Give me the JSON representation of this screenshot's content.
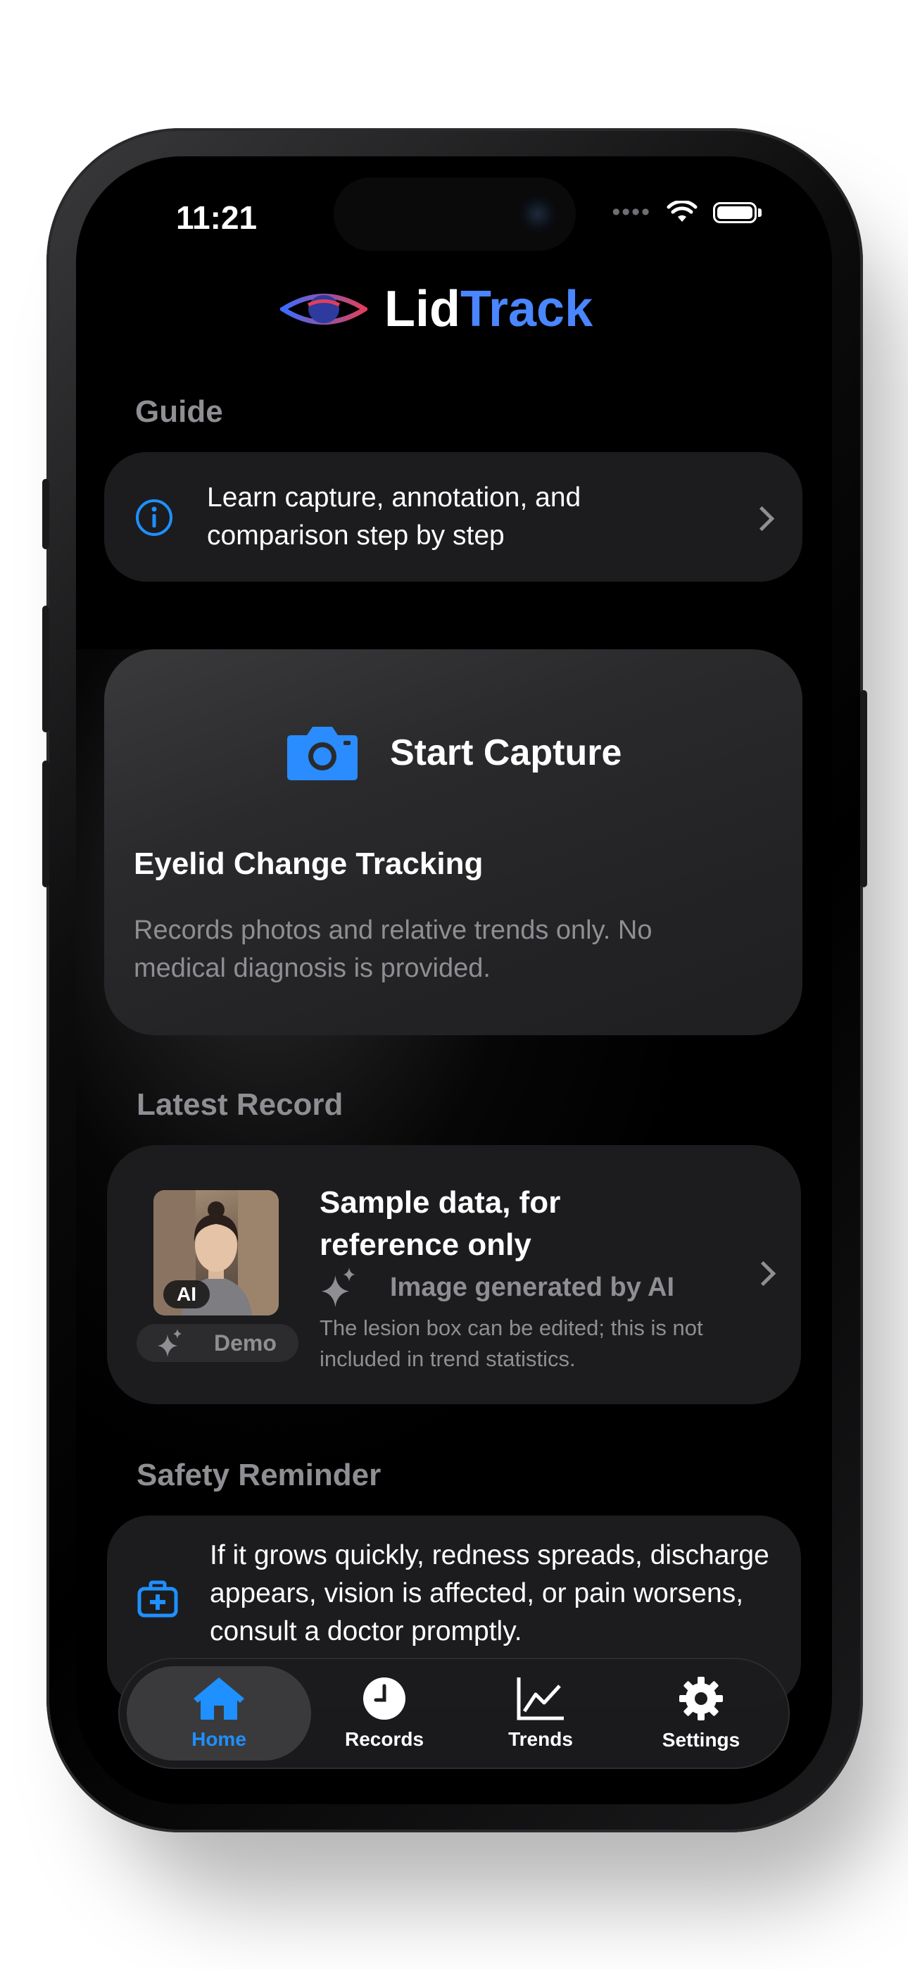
{
  "status_bar": {
    "time": "11:21"
  },
  "brand": {
    "part1": "Lid",
    "part2": "Track"
  },
  "guide": {
    "section_title": "Guide",
    "text": "Learn capture, annotation, and comparison step by step"
  },
  "capture": {
    "button_label": "Start Capture",
    "title": "Eyelid Change Tracking",
    "description": "Records photos and relative trends only. No medical diagnosis is provided."
  },
  "latest_record": {
    "section_title": "Latest Record",
    "thumbnail_badge": "AI",
    "demo_label": "Demo",
    "title": "Sample data, for reference only",
    "ai_label": "Image generated by AI",
    "description": "The lesion box can be edited; this is not included in trend statistics."
  },
  "safety": {
    "section_title": "Safety Reminder",
    "text": "If it grows quickly, redness spreads, discharge appears, vision is affected, or pain worsens, consult a doctor promptly."
  },
  "tabbar": {
    "home": "Home",
    "records": "Records",
    "trends": "Trends",
    "settings": "Settings",
    "active": "Home"
  },
  "colors": {
    "accent": "#1e90ff",
    "brand_blue": "#4a86ff",
    "card": "#1c1c1e",
    "secondary_text": "#8e8e93"
  }
}
